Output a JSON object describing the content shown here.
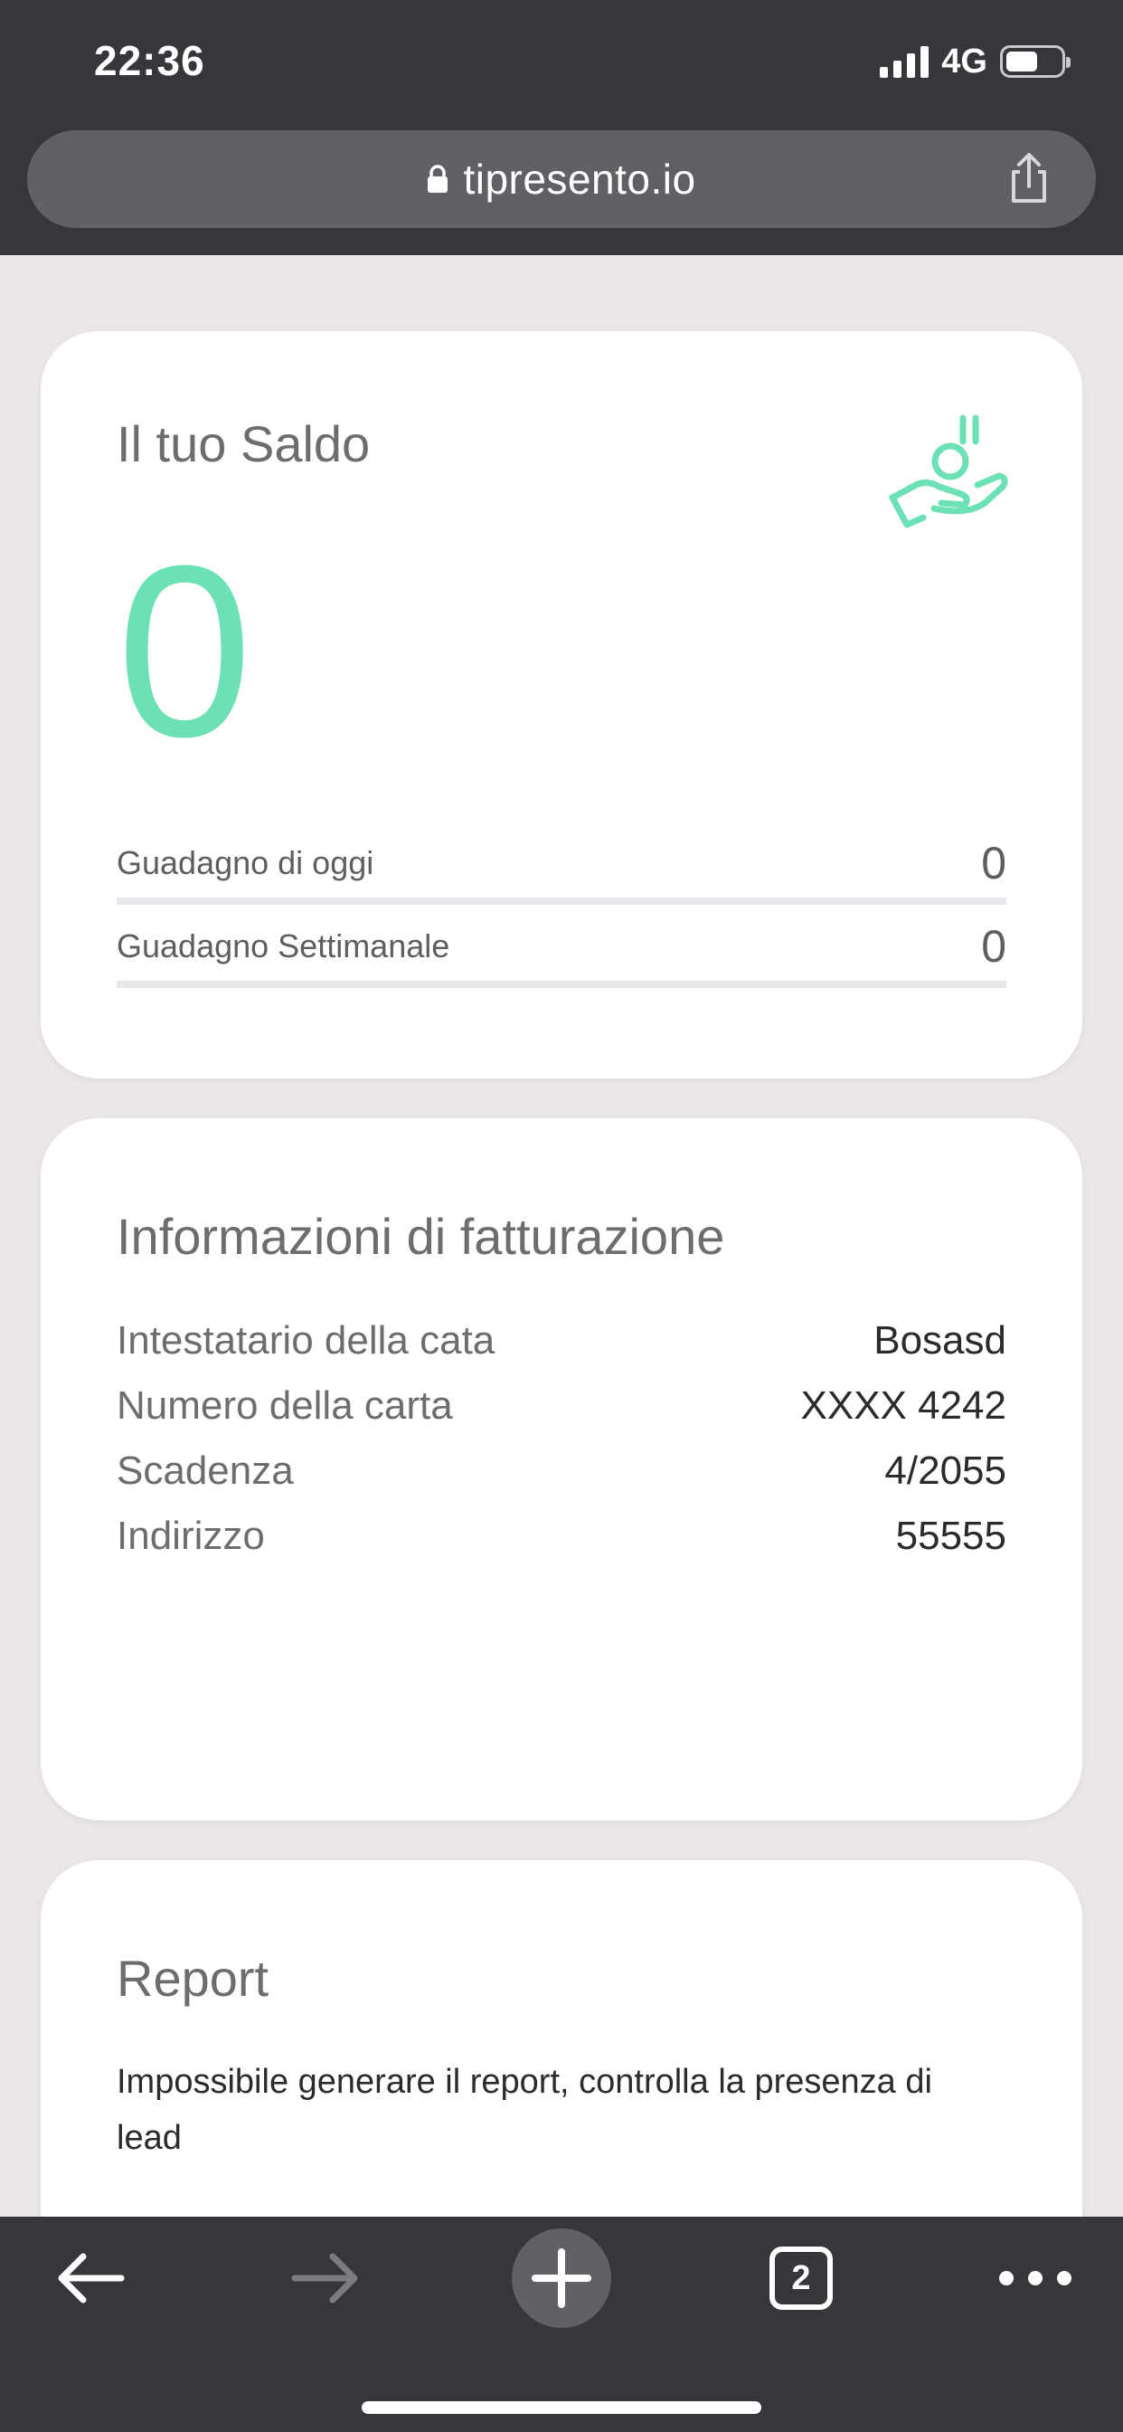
{
  "status_bar": {
    "time": "22:36",
    "network": "4G"
  },
  "browser": {
    "url": "tipresento.io",
    "tab_count": "2",
    "icons": [
      "lock-icon",
      "share-icon",
      "back-arrow-icon",
      "forward-arrow-icon",
      "plus-icon",
      "tabs-icon",
      "more-icon"
    ]
  },
  "balance_card": {
    "title": "Il tuo Saldo",
    "balance": "0",
    "icon": "hand-coin-icon",
    "rows": [
      {
        "label": "Guadagno di oggi",
        "value": "0"
      },
      {
        "label": "Guadagno Settimanale",
        "value": "0"
      }
    ],
    "accent_color": "#6ce1b5"
  },
  "billing_card": {
    "title": "Informazioni di fatturazione",
    "rows": [
      {
        "label": "Intestatario della cata",
        "value": "Bosasd"
      },
      {
        "label": "Numero della carta",
        "value": "XXXX 4242"
      },
      {
        "label": "Scadenza",
        "value": "4/2055"
      },
      {
        "label": "Indirizzo",
        "value": "55555"
      }
    ]
  },
  "report_card": {
    "title": "Report",
    "message": "Impossibile generare il report, controlla la presenza di lead"
  }
}
